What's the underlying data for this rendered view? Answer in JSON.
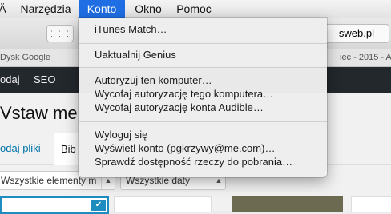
{
  "menubar": {
    "items": [
      {
        "label": "Ä",
        "active": false
      },
      {
        "label": "Narzędzia",
        "active": false
      },
      {
        "label": "Konto",
        "active": true
      },
      {
        "label": "Okno",
        "active": false
      },
      {
        "label": "Pomoc",
        "active": false
      }
    ]
  },
  "toolbar": {
    "url": "sweb.pl"
  },
  "bookmarks": {
    "left": "Dysk Google",
    "right": "iec - 2015 - A"
  },
  "adminbar": {
    "add": "odaj",
    "seo": "SEO"
  },
  "content": {
    "title": "Vstaw me",
    "tab_upload": "odaj pliki",
    "tab_library": "Bib",
    "select_types": "Wszystkie elementy m",
    "select_dates": "Wszystkie daty"
  },
  "menu": {
    "groups": [
      [
        "iTunes Match…"
      ],
      [
        "Uaktualnij Genius"
      ],
      [
        "Autoryzuj ten komputer…",
        "Wycofaj autoryzację tego komputera…",
        "Wycofaj autoryzację konta Audible…"
      ],
      [
        "Wyloguj się",
        "Wyświetl konto (pgkrzywy@me.com)…",
        "Sprawdź dostępność rzeczy do pobrania…"
      ]
    ]
  },
  "colors": {
    "menu_highlight": "#1f6ee4",
    "admin_bar": "#23282d",
    "link": "#0073aa"
  }
}
